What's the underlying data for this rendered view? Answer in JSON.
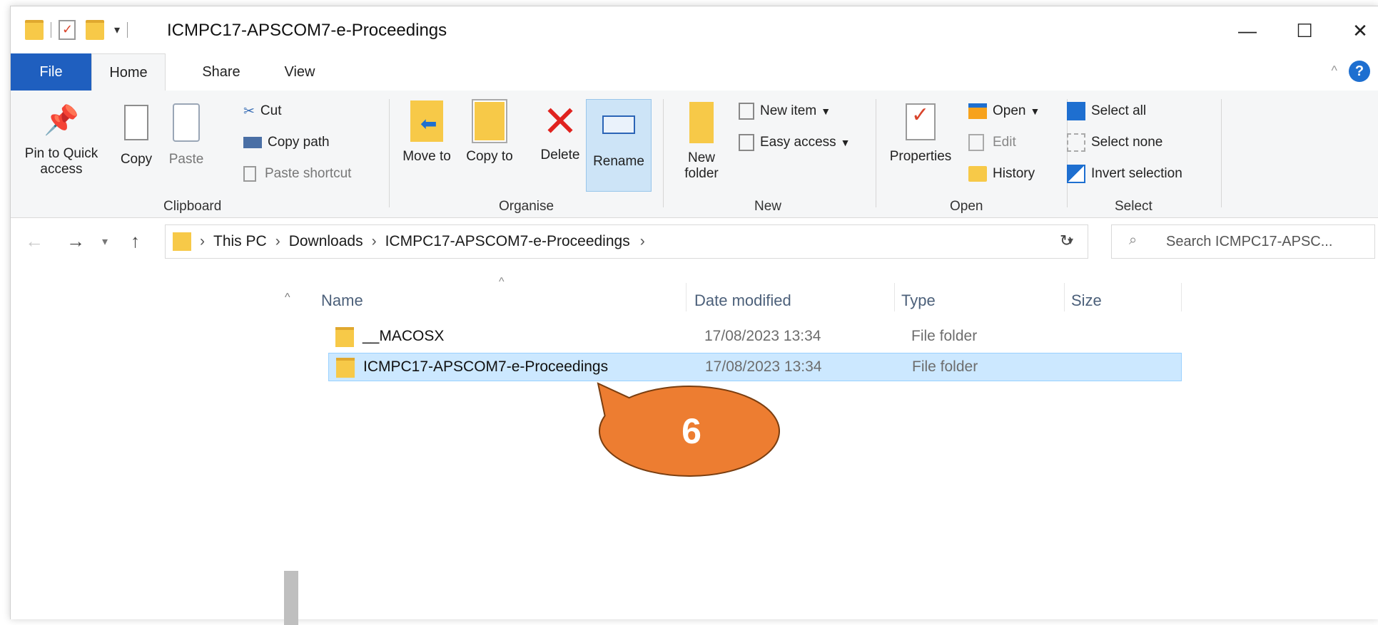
{
  "window": {
    "title": "ICMPC17-APSCOM7-e-Proceedings"
  },
  "tabs": {
    "file": "File",
    "home": "Home",
    "share": "Share",
    "view": "View"
  },
  "ribbon": {
    "clipboard": {
      "label": "Clipboard",
      "pin": "Pin to Quick access",
      "copy": "Copy",
      "paste": "Paste",
      "cut": "Cut",
      "copy_path": "Copy path",
      "paste_shortcut": "Paste shortcut"
    },
    "organise": {
      "label": "Organise",
      "move_to": "Move to",
      "copy_to": "Copy to",
      "delete": "Delete",
      "rename": "Rename"
    },
    "new": {
      "label": "New",
      "new_folder": "New folder",
      "new_item": "New item",
      "easy_access": "Easy access"
    },
    "open": {
      "label": "Open",
      "properties": "Properties",
      "open": "Open",
      "edit": "Edit",
      "history": "History"
    },
    "select": {
      "label": "Select",
      "select_all": "Select all",
      "select_none": "Select none",
      "invert": "Invert selection"
    }
  },
  "address": {
    "crumbs": [
      "This PC",
      "Downloads",
      "ICMPC17-APSCOM7-e-Proceedings"
    ],
    "search_placeholder": "Search ICMPC17-APSC..."
  },
  "columns": {
    "name": "Name",
    "date": "Date modified",
    "type": "Type",
    "size": "Size"
  },
  "files": [
    {
      "name": "__MACOSX",
      "date": "17/08/2023 13:34",
      "type": "File folder"
    },
    {
      "name": "ICMPC17-APSCOM7-e-Proceedings",
      "date": "17/08/2023 13:34",
      "type": "File folder"
    }
  ],
  "callout": {
    "number": "6",
    "fill": "#ed7d31",
    "stroke": "#7a3e10"
  },
  "colors": {
    "file_tab": "#1f5fbf",
    "selection": "#cce8ff",
    "selection_border": "#99d1ff"
  }
}
